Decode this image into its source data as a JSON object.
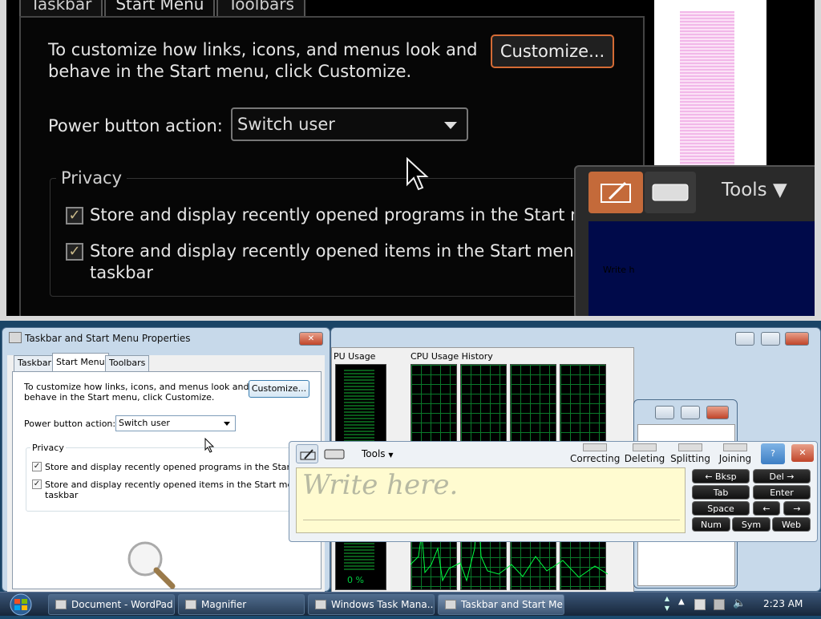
{
  "magnified": {
    "tabs": [
      "Taskbar",
      "Start Menu",
      "Toolbars"
    ],
    "customize_text": [
      "To customize how links, icons, and menus look and",
      "behave in the Start menu, click Customize."
    ],
    "customize_label": "Customize...",
    "power_label": "Power button action:",
    "power_value": "Switch user",
    "privacy_label": "Privacy",
    "check1": "Store and display recently opened programs in the Start menu",
    "check2_line1": "Store and display recently opened items in the Start menu and t",
    "check2_line2": "taskbar",
    "tools_label": "Tools",
    "write_text": "Write h"
  },
  "props_window": {
    "title": "Taskbar and Start Menu Properties",
    "tabs": [
      "Taskbar",
      "Start Menu",
      "Toolbars"
    ],
    "customize_text": [
      "To customize how links, icons, and menus look and",
      "behave in the Start menu, click Customize."
    ],
    "customize_label": "Customize...",
    "power_label": "Power button action:",
    "power_value": "Switch user",
    "privacy_label": "Privacy",
    "check1": "Store and display recently opened programs in the Start menu",
    "check2_line1": "Store and display recently opened items in the Start menu and t",
    "check2_line2": "taskbar"
  },
  "task_manager": {
    "cpu_usage_label": "PU Usage",
    "cpu_history_label": "CPU Usage History",
    "cpu_percent": "0 %"
  },
  "input_panel": {
    "tools_label": "Tools",
    "gestures": [
      "Correcting",
      "Deleting",
      "Splitting",
      "Joining"
    ],
    "write_placeholder": "Write here.",
    "keys": {
      "bksp": "Bksp",
      "del": "Del",
      "tab": "Tab",
      "enter": "Enter",
      "space": "Space",
      "left": "←",
      "right": "→",
      "num": "Num",
      "sym": "Sym",
      "web": "Web"
    }
  },
  "taskbar": {
    "items": [
      "Document - WordPad",
      "Magnifier",
      "Windows Task Mana...",
      "Taskbar and Start Me..."
    ],
    "clock": "2:23 AM"
  },
  "colors": {
    "accent_orange": "#d46b35",
    "graph_green": "#00d040",
    "desktop_blue": "#1a4466"
  }
}
